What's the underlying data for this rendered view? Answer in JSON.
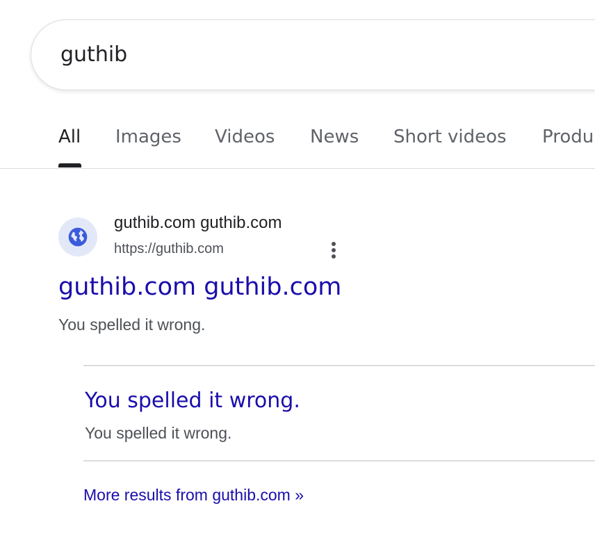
{
  "search": {
    "query": "guthib"
  },
  "tabs": [
    {
      "label": "All",
      "active": true
    },
    {
      "label": "Images",
      "active": false
    },
    {
      "label": "Videos",
      "active": false
    },
    {
      "label": "News",
      "active": false
    },
    {
      "label": "Short videos",
      "active": false
    },
    {
      "label": "Produ",
      "active": false
    }
  ],
  "result": {
    "favicon_icon": "globe-icon",
    "site_name": "guthib.com guthib.com",
    "url": "https://guthib.com",
    "menu_icon": "more-vert-icon",
    "title": "guthib.com guthib.com",
    "snippet": "You spelled it wrong.",
    "sitelink": {
      "title": "You spelled it wrong.",
      "snippet": "You spelled it wrong."
    },
    "more_results": "More results from guthib.com »"
  },
  "colors": {
    "link": "#1a0dab",
    "favicon_bg": "#e3e8f9",
    "favicon_fg": "#3b5bdb",
    "divider": "#dadce0"
  }
}
